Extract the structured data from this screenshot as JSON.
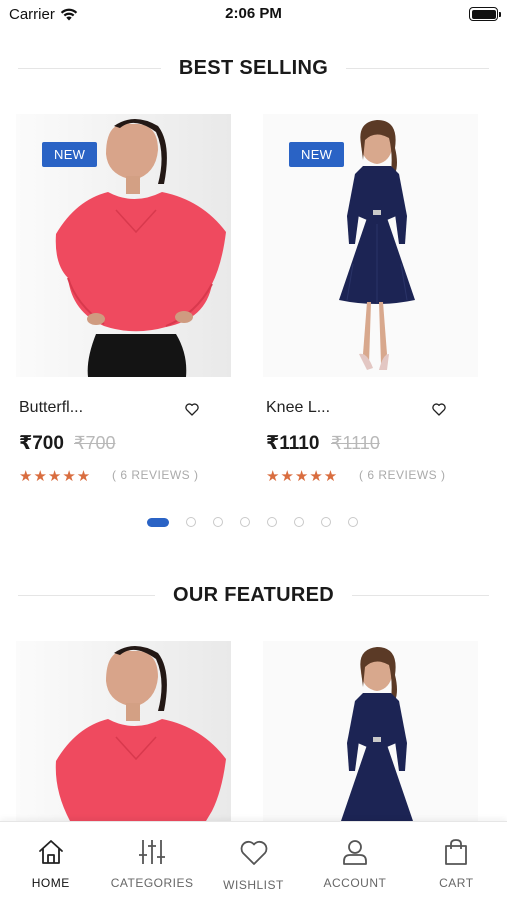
{
  "status_bar": {
    "carrier": "Carrier",
    "time": "2:06 PM"
  },
  "sections": {
    "best_selling": "BEST SELLING",
    "our_featured": "OUR FEATURED"
  },
  "best_selling_products": [
    {
      "badge": "NEW",
      "name": "Butterfl...",
      "price": "₹700",
      "old_price": "₹700",
      "rating": 5,
      "stars": "★★★★★",
      "reviews": "( 6 REVIEWS )"
    },
    {
      "badge": "NEW",
      "name": "Knee L...",
      "price": "₹1110",
      "old_price": "₹1110",
      "rating": 5,
      "stars": "★★★★★",
      "reviews": "( 6 REVIEWS )"
    }
  ],
  "pager": {
    "pages": 8,
    "active": 1
  },
  "tabbar": {
    "items": [
      {
        "label": "HOME",
        "icon": "home-icon",
        "active": true
      },
      {
        "label": "CATEGORIES",
        "icon": "sliders-icon",
        "active": false
      },
      {
        "label": "WISHLIST",
        "icon": "heart-icon",
        "active": false
      },
      {
        "label": "ACCOUNT",
        "icon": "user-icon",
        "active": false
      },
      {
        "label": "CART",
        "icon": "bag-icon",
        "active": false
      }
    ]
  },
  "colors": {
    "accent": "#2a63c5",
    "star": "#d96d3f",
    "blouse": "#ef4a5f",
    "dress": "#1c2454"
  }
}
